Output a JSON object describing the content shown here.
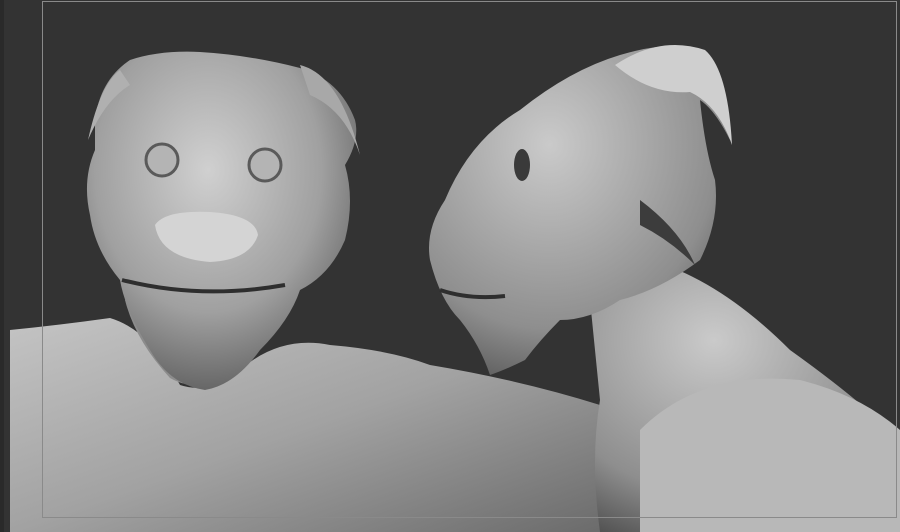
{
  "colors": {
    "background": "#333333",
    "frame": "#8a8a8a",
    "clay_light": "#c8c8c8",
    "clay_mid": "#9a9a9a",
    "clay_dark": "#4a4a4a"
  },
  "icons": [
    "document-frame",
    "sculpt-front-view",
    "sculpt-side-view"
  ]
}
